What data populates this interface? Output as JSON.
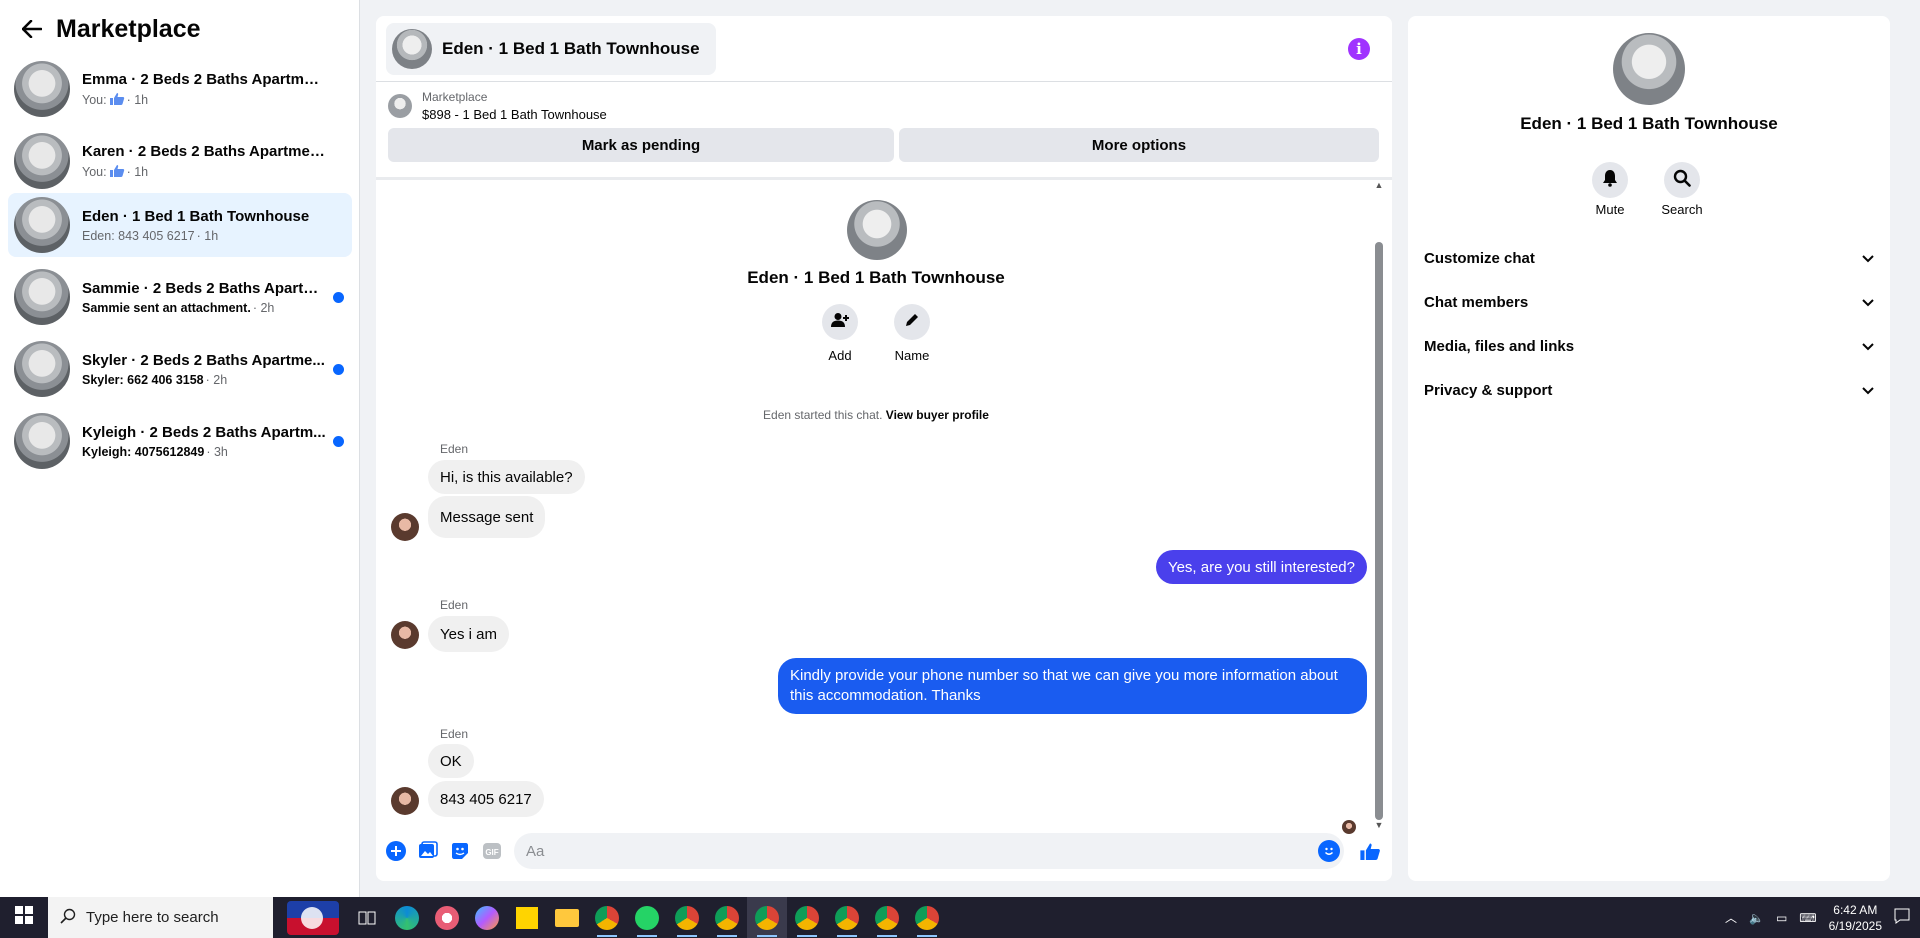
{
  "sidebar": {
    "title": "Marketplace",
    "conversations": [
      {
        "title": "Emma · 2 Beds 2 Baths Apartment...",
        "prefix": "You:",
        "like": true,
        "time": "· 1h",
        "bold": false,
        "unread": false,
        "active": false
      },
      {
        "title": "Karen · 2 Beds 2 Baths Apartment/...",
        "prefix": "You:",
        "like": true,
        "time": "· 1h",
        "bold": false,
        "unread": false,
        "active": false
      },
      {
        "title": "Eden · 1 Bed 1 Bath Townhouse",
        "prefix": "Eden: 843 405 6217",
        "like": false,
        "time": "· 1h",
        "bold": false,
        "unread": false,
        "active": true
      },
      {
        "title": "Sammie · 2 Beds 2 Baths Apartm...",
        "prefix": "Sammie sent an attachment.",
        "like": false,
        "time": "· 2h",
        "bold": true,
        "unread": true,
        "active": false
      },
      {
        "title": "Skyler · 2 Beds 2 Baths Apartme...",
        "prefix": "Skyler: 662 406 3158",
        "like": false,
        "time": "· 2h",
        "bold": true,
        "unread": true,
        "active": false
      },
      {
        "title": "Kyleigh · 2 Beds 2 Baths Apartm...",
        "prefix": "Kyleigh: 4075612849",
        "like": false,
        "time": "· 3h",
        "bold": true,
        "unread": true,
        "active": false
      }
    ]
  },
  "chat": {
    "header_title": "Eden · 1 Bed 1 Bath Townhouse",
    "info_glyph": "i",
    "listing_label": "Marketplace",
    "listing_price": "$898 - 1 Bed 1 Bath Townhouse",
    "mark_pending": "Mark as pending",
    "more_options": "More options",
    "intro_title": "Eden · 1 Bed 1 Bath Townhouse",
    "add_label": "Add",
    "name_label": "Name",
    "started_text": "Eden started this chat.",
    "buyer_profile_link": "View buyer profile",
    "messages": [
      {
        "sender": "Eden",
        "text": "Hi, is this available?"
      },
      {
        "text": "Message sent"
      },
      {
        "text": "Yes, are you still interested?"
      },
      {
        "sender": "Eden",
        "text": "Yes i am"
      },
      {
        "text": "Kindly provide your phone number so that we can give you more information about this accommodation. Thanks"
      },
      {
        "sender": "Eden",
        "text": "OK"
      },
      {
        "text": "843 405 6217"
      }
    ],
    "composer_placeholder": "Aa"
  },
  "details": {
    "title": "Eden · 1 Bed 1 Bath Townhouse",
    "mute_label": "Mute",
    "search_label": "Search",
    "sections": [
      "Customize chat",
      "Chat members",
      "Media, files and links",
      "Privacy & support"
    ]
  },
  "taskbar": {
    "search_placeholder": "Type here to search",
    "time": "6:42 AM",
    "date": "6/19/2025"
  },
  "colors": {
    "accent": "#0866ff",
    "outgoing_bubble": "#4a40ec",
    "outgoing_bubble_2": "#1a5cf0",
    "active_conv": "#e7f3ff",
    "info_icon": "#a033ff"
  }
}
